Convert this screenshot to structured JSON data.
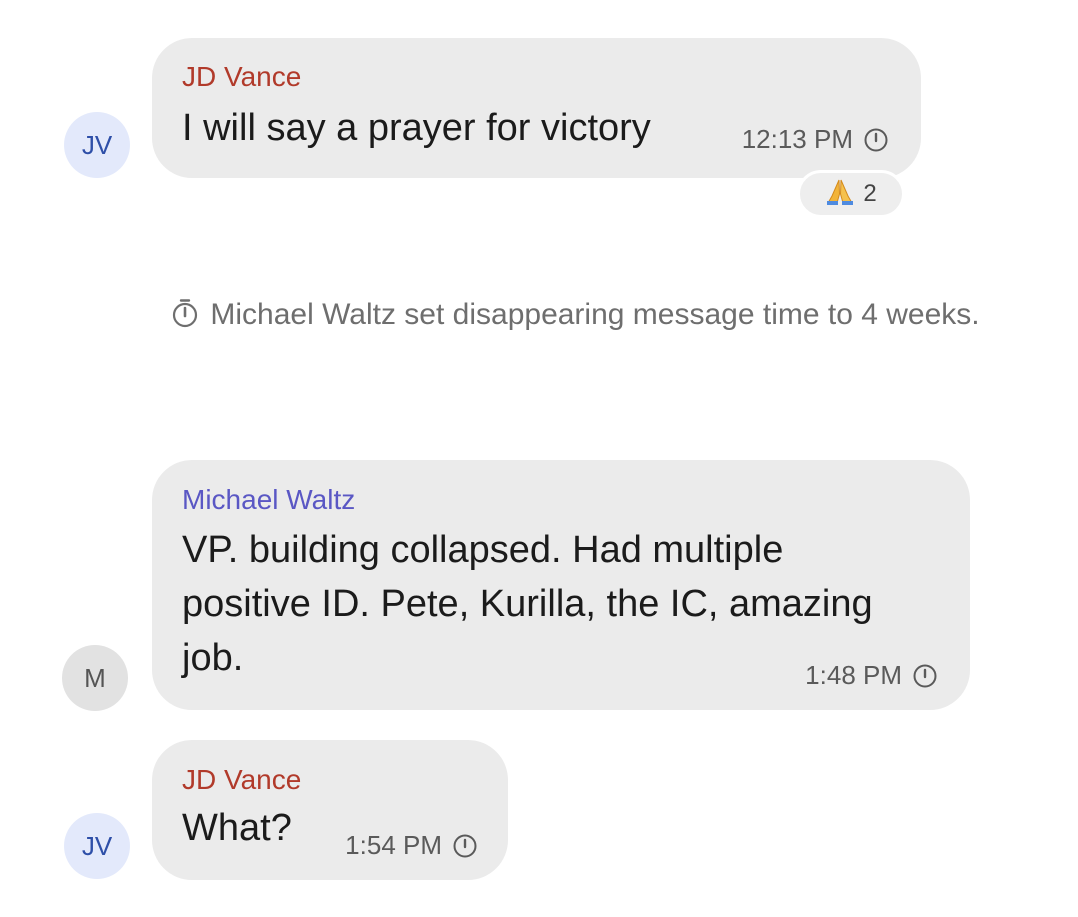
{
  "messages": [
    {
      "avatar": "JV",
      "sender": "JD Vance",
      "text_lines": [
        "I will say a prayer for victory"
      ],
      "time": "12:13 PM",
      "icon": "disappearing-timer-icon",
      "reaction": {
        "emoji": "🙏",
        "count": "2"
      }
    },
    {
      "avatar": "M",
      "sender": "Michael Waltz",
      "text_lines": [
        "VP.  building collapsed. Had multiple",
        "positive ID. Pete, Kurilla, the IC, amazing",
        "job."
      ],
      "time": "1:48 PM",
      "icon": "disappearing-timer-icon"
    },
    {
      "avatar": "JV",
      "sender": "JD Vance",
      "text_lines": [
        "What?"
      ],
      "time": "1:54 PM",
      "icon": "disappearing-timer-icon"
    }
  ],
  "system": {
    "text": "Michael Waltz set disappearing message time to 4 weeks.",
    "icon": "disappearing-timer-icon"
  },
  "colors": {
    "vance_name": "#b13a2a",
    "waltz_name": "#5a57c4",
    "bubble": "#ebebeb",
    "jv_avatar_bg": "#e3e9fb",
    "jv_avatar_text": "#2e4fa8",
    "m_avatar_bg": "#e2e2e2"
  }
}
